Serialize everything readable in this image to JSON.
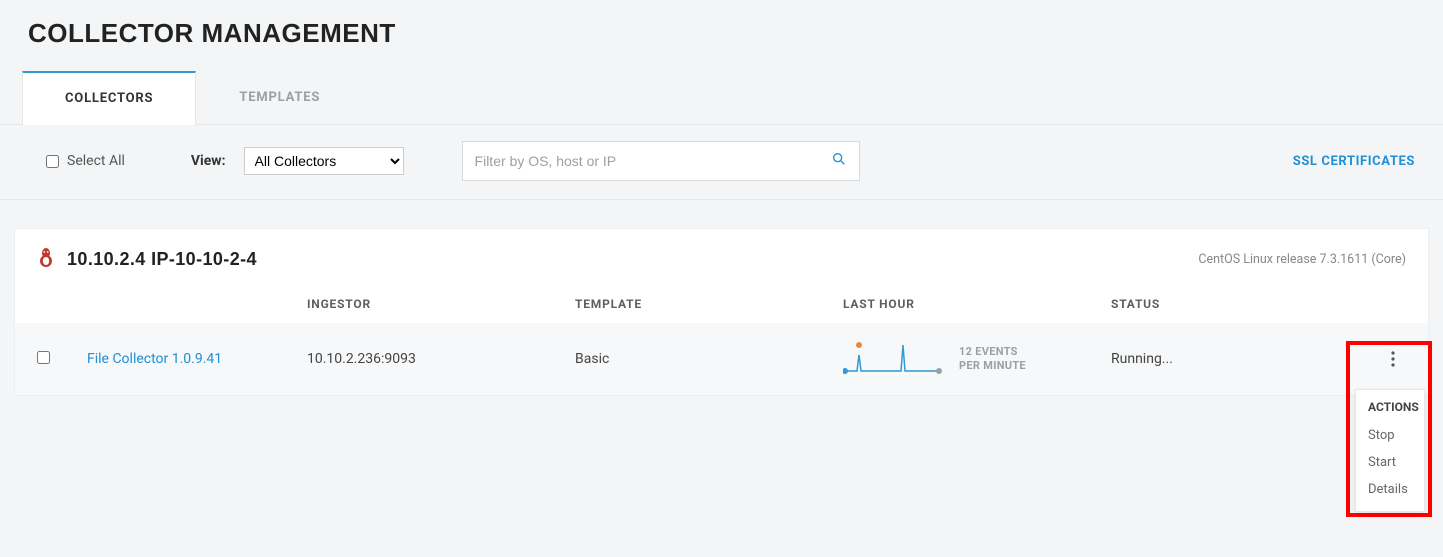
{
  "page": {
    "title": "COLLECTOR MANAGEMENT"
  },
  "tabs": {
    "collectors": "COLLECTORS",
    "templates": "TEMPLATES"
  },
  "toolbar": {
    "select_all_label": "Select All",
    "view_label": "View:",
    "view_options": [
      "All Collectors"
    ],
    "view_selected": "All Collectors",
    "filter_placeholder": "Filter by OS, host or IP",
    "ssl_link": "SSL CERTIFICATES"
  },
  "host": {
    "ip": "10.10.2.4",
    "name": "IP-10-10-2-4",
    "title": "10.10.2.4 IP-10-10-2-4",
    "os_release": "CentOS Linux release 7.3.1611 (Core)"
  },
  "columns": {
    "ingestor": "INGESTOR",
    "template": "TEMPLATE",
    "last_hour": "LAST HOUR",
    "status": "STATUS"
  },
  "rows": [
    {
      "name": "File Collector 1.0.9.41",
      "ingestor": "10.10.2.236:9093",
      "template": "Basic",
      "events_line1": "12 EVENTS",
      "events_line2": "PER MINUTE",
      "status": "Running..."
    }
  ],
  "actions_menu": {
    "title": "ACTIONS",
    "items": [
      "Stop",
      "Start",
      "Details"
    ]
  }
}
